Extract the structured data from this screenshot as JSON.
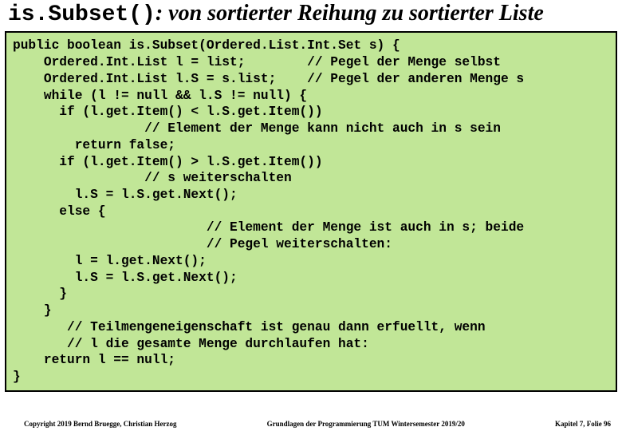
{
  "title": {
    "mono": "is.Subset()",
    "rest": ": von sortierter Reihung zu sortierter Liste"
  },
  "code": {
    "lines": [
      "public boolean is.Subset(Ordered.List.Int.Set s) {",
      "    Ordered.Int.List l = list;        // Pegel der Menge selbst",
      "    Ordered.Int.List l.S = s.list;    // Pegel der anderen Menge s",
      "    while (l != null && l.S != null) {",
      "      if (l.get.Item() < l.S.get.Item())",
      "                 // Element der Menge kann nicht auch in s sein",
      "        return false;",
      "      if (l.get.Item() > l.S.get.Item())",
      "                 // s weiterschalten",
      "        l.S = l.S.get.Next();",
      "      else {",
      "                         // Element der Menge ist auch in s; beide",
      "                         // Pegel weiterschalten:",
      "        l = l.get.Next();",
      "        l.S = l.S.get.Next();",
      "      }",
      "    }",
      "       // Teilmengeneigenschaft ist genau dann erfuellt, wenn",
      "       // l die gesamte Menge durchlaufen hat:",
      "    return l == null;",
      "}"
    ]
  },
  "footer": {
    "left": "Copyright 2019 Bernd Bruegge, Christian Herzog",
    "center": "Grundlagen der Programmierung TUM Wintersemester 2019/20",
    "right": "Kapitel 7, Folie 96"
  }
}
